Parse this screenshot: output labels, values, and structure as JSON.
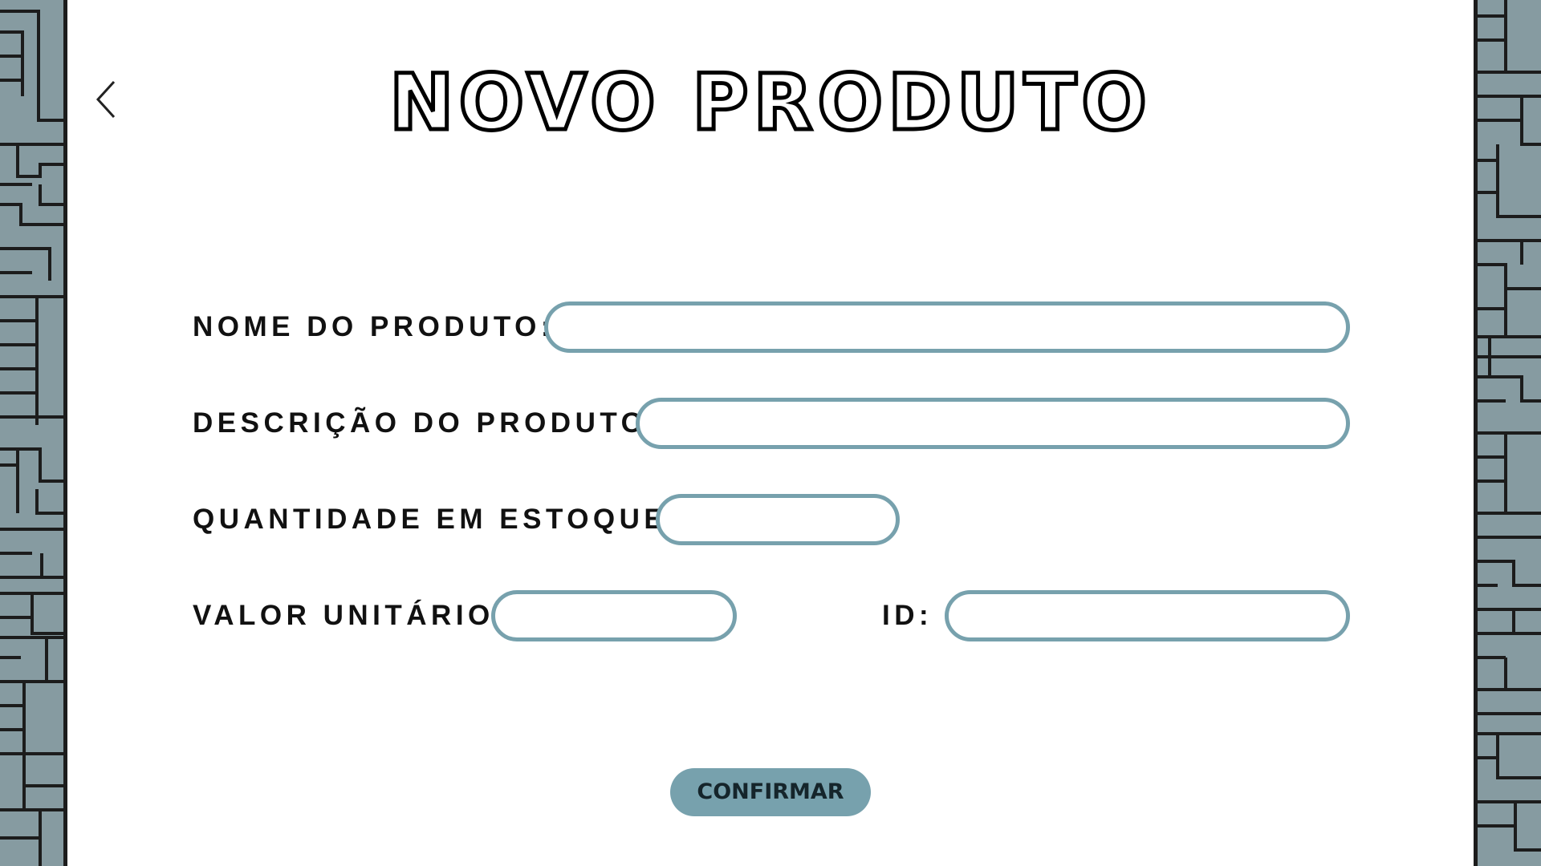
{
  "title": "NOVO PRODUTO",
  "back_icon": "chevron-left-icon",
  "colors": {
    "accent": "#77a1ad",
    "border_pattern": "#869ba1",
    "text": "#111111"
  },
  "form": {
    "nome_label": "NOME DO PRODUTO:",
    "nome_value": "",
    "descricao_label": "DESCRIÇÃO DO PRODUTO:",
    "descricao_value": "",
    "quantidade_label": "QUANTIDADE EM ESTOQUE:",
    "quantidade_value": "",
    "valor_label": "VALOR UNITÁRIO:",
    "valor_value": "",
    "id_label": "ID:",
    "id_value": ""
  },
  "confirm_label": "CONFIRMAR"
}
